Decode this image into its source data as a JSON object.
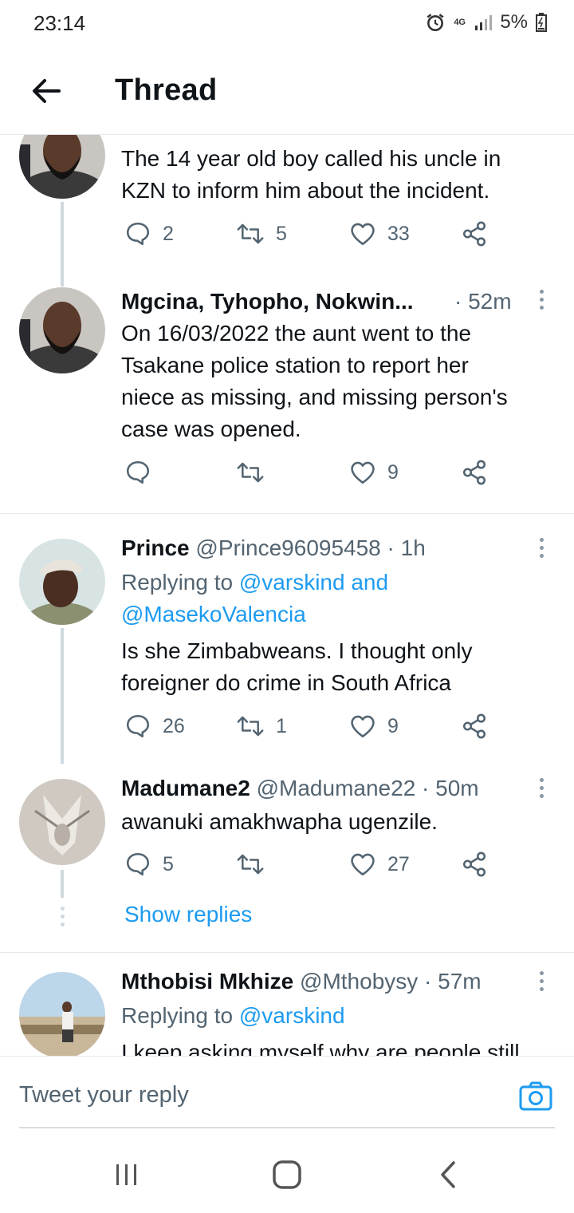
{
  "status_bar": {
    "time": "23:14",
    "network": "4G",
    "battery": "5%"
  },
  "header": {
    "title": "Thread"
  },
  "tweets": [
    {
      "name": "",
      "handle": "",
      "time": "",
      "lines": [
        "The 14 year old boy called his uncle in",
        "KZN to inform him about the incident."
      ],
      "replies": "2",
      "retweets": "5",
      "likes": "33"
    },
    {
      "name": "Mgcina, Tyhopho, Nokwin...",
      "handle": "",
      "time": "· 52m",
      "lines": [
        "On 16/03/2022 the aunt went to the",
        "Tsakane police station to report her",
        "niece as missing, and missing person's",
        "case was opened."
      ],
      "replies": "",
      "retweets": "",
      "likes": "9"
    },
    {
      "name": "Prince",
      "handle": "@Prince96095458",
      "time": "· 1h",
      "replying_prefix": "Replying to",
      "replying_line1": "@varskind and",
      "replying_line2": "@MasekoValencia",
      "lines": [
        "Is she Zimbabweans.  I thought only",
        "foreigner do crime in South Africa"
      ],
      "replies": "26",
      "retweets": "1",
      "likes": "9"
    },
    {
      "name": "Madumane2",
      "handle": "@Madumane22",
      "time": "· 50m",
      "lines": [
        "awanuki amakhwapha ugenzile."
      ],
      "replies": "5",
      "retweets": "",
      "likes": "27",
      "show_replies": "Show replies"
    },
    {
      "name": "Mthobisi Mkhize",
      "handle": "@Mthobysy",
      "time": "· 57m",
      "replying_prefix": "Replying to",
      "replying_line1": "@varskind",
      "lines": [
        "I keep asking myself why are people still"
      ]
    }
  ],
  "compose": {
    "placeholder": "Tweet your reply"
  },
  "icons": {
    "back": "arrow-left-icon",
    "reply": "reply-icon",
    "retweet": "retweet-icon",
    "like": "heart-icon",
    "share": "share-icon",
    "more": "more-vertical-icon",
    "camera": "camera-icon",
    "nav_recent": "recent-apps-icon",
    "nav_home": "home-icon",
    "nav_back": "nav-back-icon"
  },
  "colors": {
    "accent": "#1d9bf0",
    "text": "#0f1419",
    "muted": "#536471",
    "line": "#cfd9de"
  }
}
